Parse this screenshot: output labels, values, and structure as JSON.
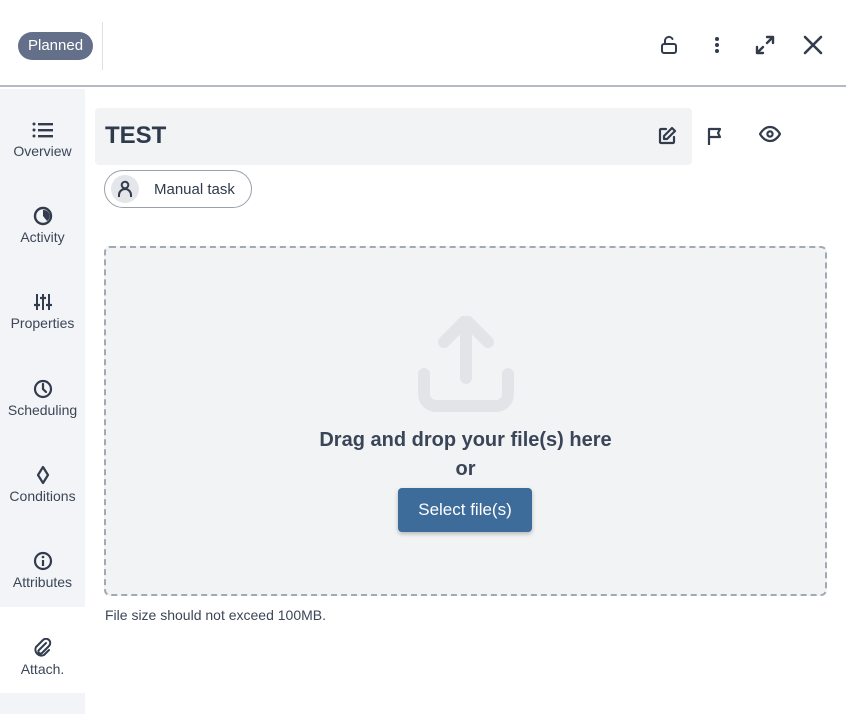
{
  "header": {
    "status_badge": "Planned",
    "icons": [
      "unlock-icon",
      "more-vertical-icon",
      "expand-icon",
      "close-icon"
    ]
  },
  "sidebar": {
    "items": [
      {
        "label": "Overview",
        "icon": "list-icon",
        "active": false
      },
      {
        "label": "Activity",
        "icon": "pie-clock-icon",
        "active": false
      },
      {
        "label": "Properties",
        "icon": "sliders-icon",
        "active": false
      },
      {
        "label": "Scheduling",
        "icon": "clock-icon",
        "active": false
      },
      {
        "label": "Conditions",
        "icon": "diamond-icon",
        "active": false
      },
      {
        "label": "Attributes",
        "icon": "info-icon",
        "active": false
      },
      {
        "label": "Attach.",
        "icon": "paperclip-icon",
        "active": true
      }
    ]
  },
  "task": {
    "title": "TEST",
    "type_chip": "Manual task",
    "title_icons": [
      "edit-icon",
      "flag-icon",
      "eye-icon"
    ]
  },
  "dropzone": {
    "line1": "Drag and drop your file(s) here",
    "line2": "or",
    "button": "Select file(s)",
    "note": "File size should not exceed 100MB."
  },
  "colors": {
    "badge": "#64708a",
    "button": "#3d6b9a",
    "text": "#323c4d"
  }
}
